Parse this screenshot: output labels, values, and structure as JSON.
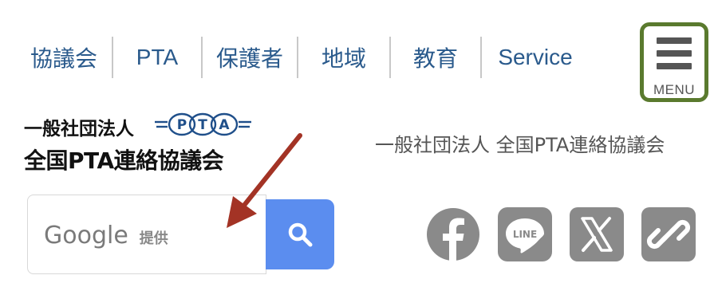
{
  "nav": {
    "items": [
      {
        "label": "協議会"
      },
      {
        "label": "PTA"
      },
      {
        "label": "保護者"
      },
      {
        "label": "地域"
      },
      {
        "label": "教育"
      },
      {
        "label": "Service"
      }
    ],
    "menu_label": "MENU"
  },
  "logo": {
    "line1": "一般社団法人",
    "line2": "全国PTA連絡協議会",
    "mark_letters": [
      "P",
      "T",
      "A"
    ]
  },
  "header": {
    "org_name": "一般社団法人 全国PTA連絡協議会"
  },
  "search": {
    "placeholder_brand": "Google",
    "placeholder_suffix": "提供",
    "button_icon": "search-icon"
  },
  "social": {
    "items": [
      {
        "icon": "facebook-icon"
      },
      {
        "icon": "line-icon",
        "label": "LINE"
      },
      {
        "icon": "x-icon"
      },
      {
        "icon": "link-icon"
      }
    ]
  },
  "colors": {
    "nav_text": "#2a5a8c",
    "menu_border": "#5a7a2e",
    "search_button": "#5b8def",
    "social_icon": "#8a8a8a",
    "annotation_arrow": "#a33325"
  }
}
